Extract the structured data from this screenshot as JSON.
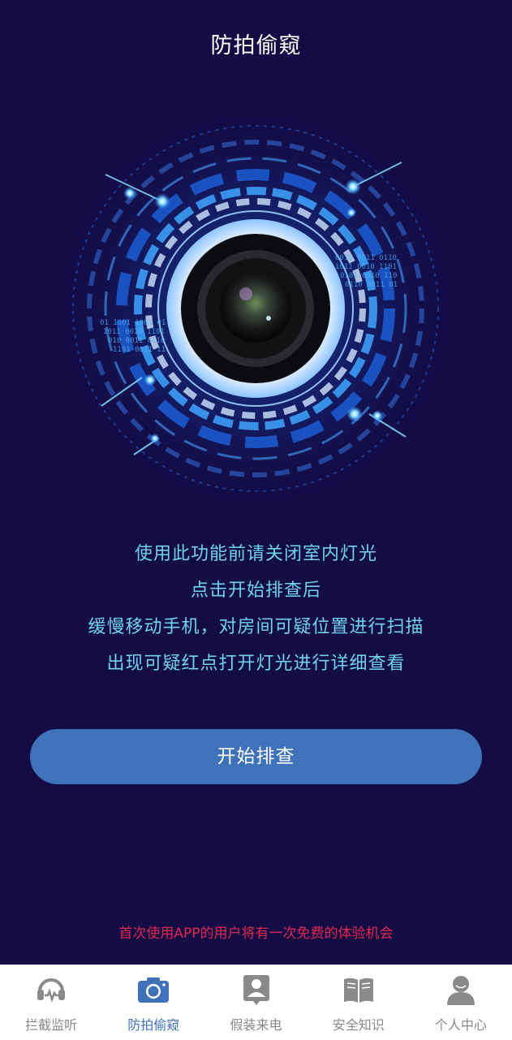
{
  "header": {
    "title": "防拍偷窥"
  },
  "instructions": [
    "使用此功能前请关闭室内灯光",
    "点击开始排查后",
    "缓慢移动手机，对房间可疑位置进行扫描",
    "出现可疑红点打开灯光进行详细查看"
  ],
  "start_button": {
    "label": "开始排查"
  },
  "notice": {
    "text": "首次使用APP的用户将有一次免费的体验机会"
  },
  "hero_binary_text": {
    "right": [
      "0010 0011 0110",
      "1011 0010 1101",
      "0101 0010 110",
      "0110 0011 01"
    ],
    "left": [
      "01 1001 1001 01",
      "1011 0010 1101",
      "010 0011 0110",
      "1101 0011 11"
    ]
  },
  "tabbar": {
    "active_index": 1,
    "tabs": [
      {
        "label": "拦截监听",
        "icon": "headset-icon"
      },
      {
        "label": "防拍偷窥",
        "icon": "camera-icon"
      },
      {
        "label": "假装来电",
        "icon": "contact-card-icon"
      },
      {
        "label": "安全知识",
        "icon": "book-icon"
      },
      {
        "label": "个人中心",
        "icon": "user-icon"
      }
    ]
  },
  "colors": {
    "background": "#140c45",
    "accent": "#3f72b9",
    "instruction_text": "#6fd3ec",
    "notice_text": "#e0284f",
    "tab_inactive": "#888888"
  }
}
